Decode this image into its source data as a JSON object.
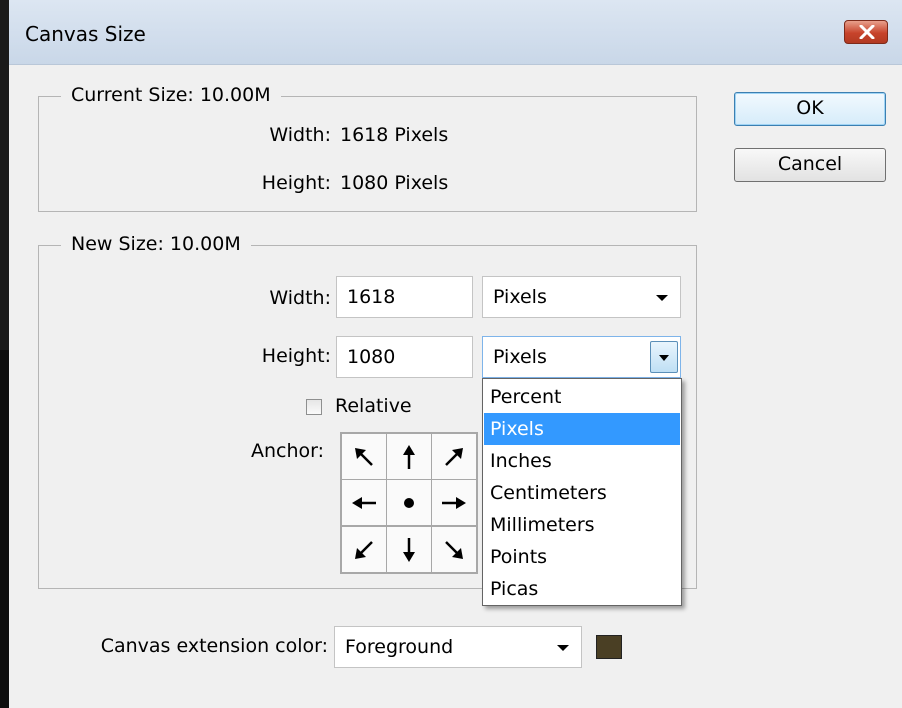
{
  "window": {
    "title": "Canvas Size"
  },
  "buttons": {
    "ok": "OK",
    "cancel": "Cancel"
  },
  "current_size": {
    "legend": "Current Size: 10.00M",
    "width_label": "Width:",
    "width_value": "1618 Pixels",
    "height_label": "Height:",
    "height_value": "1080 Pixels"
  },
  "new_size": {
    "legend": "New Size: 10.00M",
    "width_label": "Width:",
    "width_value": "1618",
    "width_unit": "Pixels",
    "height_label": "Height:",
    "height_value": "1080",
    "height_unit": "Pixels",
    "relative_label": "Relative",
    "relative_checked": false,
    "anchor_label": "Anchor:"
  },
  "unit_options": [
    "Percent",
    "Pixels",
    "Inches",
    "Centimeters",
    "Millimeters",
    "Points",
    "Picas"
  ],
  "unit_selected": "Pixels",
  "extension": {
    "label": "Canvas extension color:",
    "value": "Foreground",
    "swatch_color": "#4a3f24"
  },
  "colors": {
    "selection": "#3399ff",
    "close_button": "#c7432b"
  }
}
